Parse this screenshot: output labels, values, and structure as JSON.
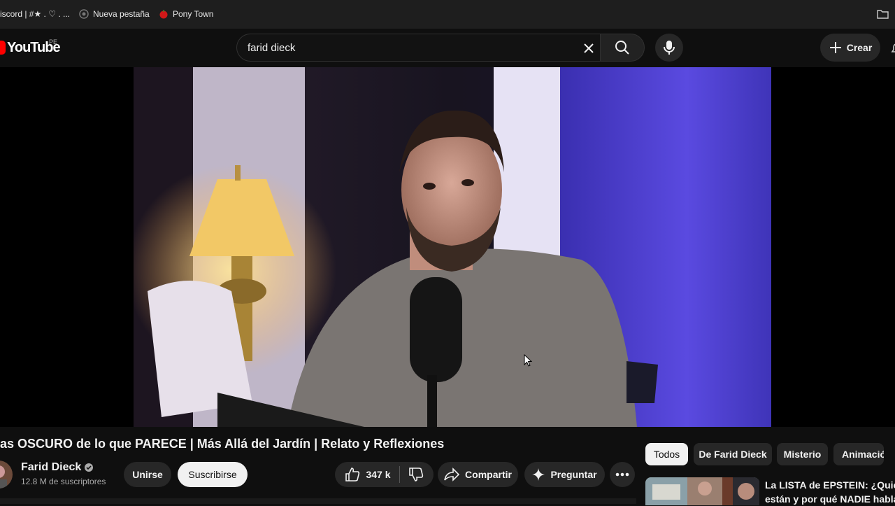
{
  "bookmarks": [
    {
      "label": "iscord | #★ . ♡ . ..."
    },
    {
      "label": "Nueva pestaña"
    },
    {
      "label": "Pony Town"
    }
  ],
  "header": {
    "logo_text": "YouTube",
    "country_code": "PE",
    "search_value": "farid dieck",
    "create_label": "Crear"
  },
  "video": {
    "title": "as OSCURO de lo que PARECE | Más Allá del Jardín | Relato y Reflexiones"
  },
  "channel": {
    "name": "Farid Dieck",
    "subscribers": "12.8 M de suscriptores",
    "join_label": "Unirse",
    "subscribe_label": "Suscribirse"
  },
  "actions": {
    "likes": "347 k",
    "share_label": "Compartir",
    "ask_label": "Preguntar"
  },
  "chips": [
    {
      "label": "Todos",
      "active": true
    },
    {
      "label": "De Farid Dieck"
    },
    {
      "label": "Misterio"
    },
    {
      "label": "Animació"
    }
  ],
  "recommendation": {
    "title_line1": "La LISTA de EPSTEIN: ¿Quién",
    "title_line2": "están y por qué NADIE habla d"
  },
  "colors": {
    "brand": "#ff0000",
    "background": "#0f0f0f",
    "surface": "#272727"
  }
}
